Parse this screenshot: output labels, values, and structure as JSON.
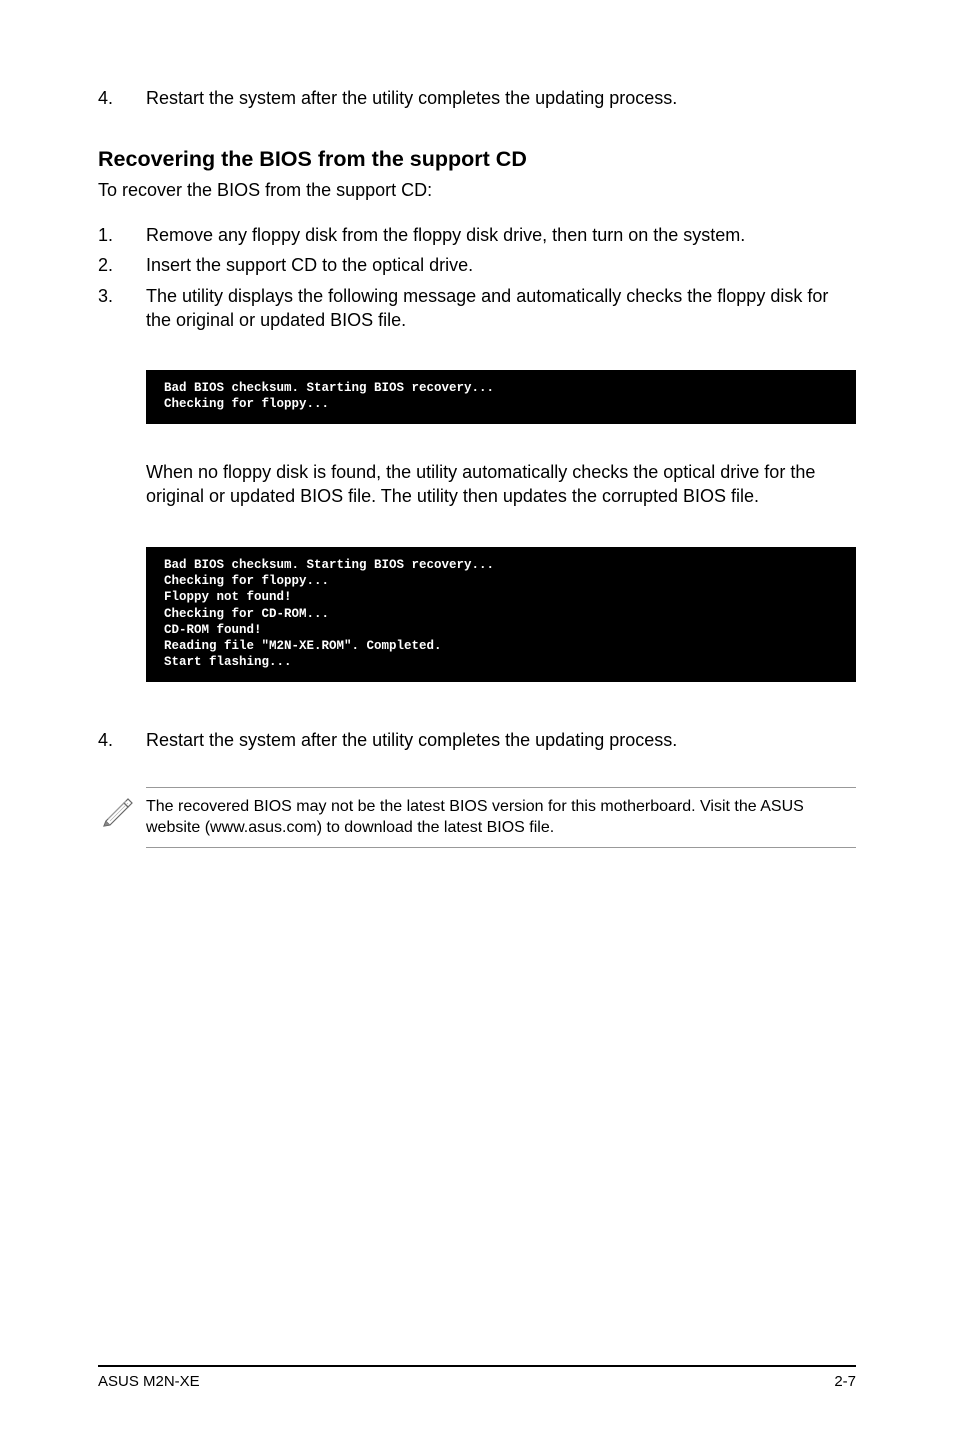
{
  "top_step": {
    "num": "4.",
    "text": "Restart the system after the utility completes the updating process."
  },
  "heading": "Recovering the BIOS from the support CD",
  "intro": "To recover the BIOS from the support CD:",
  "steps": [
    {
      "num": "1.",
      "text": "Remove any floppy disk from the floppy disk drive, then turn on the system."
    },
    {
      "num": "2.",
      "text": "Insert the support CD to the optical drive."
    },
    {
      "num": "3.",
      "text": "The utility displays the following message and automatically checks the floppy disk for the original or updated BIOS file."
    }
  ],
  "terminal1": "Bad BIOS checksum. Starting BIOS recovery...\nChecking for floppy...",
  "paragraph": "When no floppy disk is found, the utility automatically checks the optical drive for the original or updated BIOS file. The utility then updates the corrupted BIOS file.",
  "terminal2": "Bad BIOS checksum. Starting BIOS recovery...\nChecking for floppy...\nFloppy not found!\nChecking for CD-ROM...\nCD-ROM found!\nReading file \"M2N-XE.ROM\". Completed.\nStart flashing...",
  "bottom_step": {
    "num": "4.",
    "text": "Restart the system after the utility completes the updating process."
  },
  "note": "The recovered BIOS may not be the latest BIOS version for this motherboard. Visit the ASUS website (www.asus.com) to download the latest BIOS file.",
  "footer_left": "ASUS M2N-XE",
  "footer_right": "2-7"
}
